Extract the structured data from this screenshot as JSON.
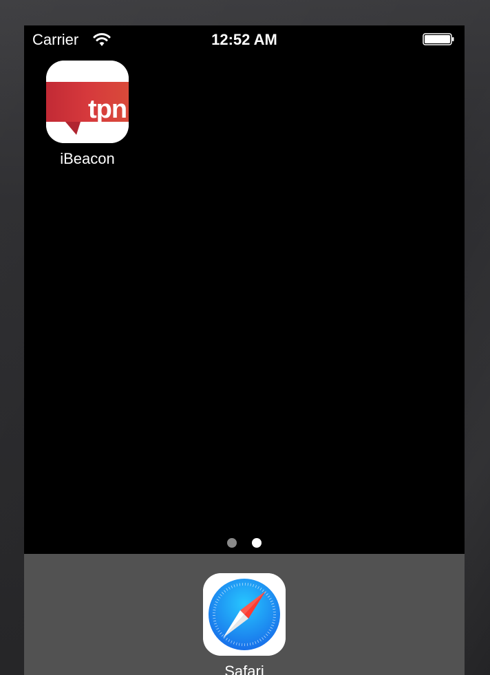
{
  "status_bar": {
    "carrier": "Carrier",
    "time": "12:52 AM",
    "wifi_icon": "wifi-icon",
    "battery_icon": "battery-icon"
  },
  "home_screen": {
    "apps": [
      {
        "label": "iBeacon",
        "icon": "tpn-logo-icon",
        "icon_text": "tpn",
        "accent": "#d3343c"
      }
    ],
    "page_indicator": {
      "pages": 2,
      "current_page": 2
    }
  },
  "dock": {
    "apps": [
      {
        "label": "Safari",
        "icon": "safari-compass-icon",
        "accent": "#1f8bff"
      }
    ]
  },
  "colors": {
    "screen_background": "#000000",
    "dock_background": "#525252",
    "bezel": "#2a2a2c"
  }
}
